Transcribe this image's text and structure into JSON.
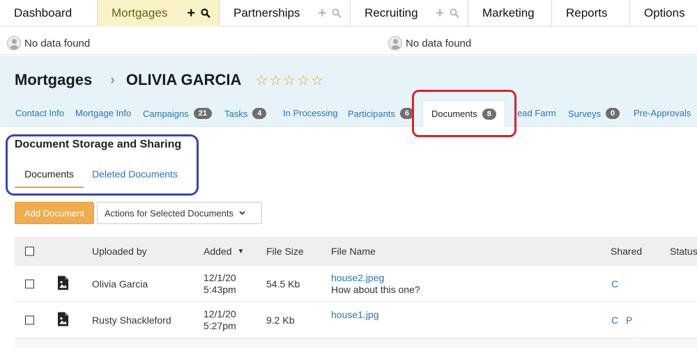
{
  "topnav": {
    "dashboard": "Dashboard",
    "mortgages": "Mortgages",
    "partnerships": "Partnerships",
    "recruiting": "Recruiting",
    "marketing": "Marketing",
    "reports": "Reports",
    "options": "Options",
    "plus": "+",
    "search_icon": "search-icon"
  },
  "status": {
    "left": "No data found",
    "right": "No data found"
  },
  "header": {
    "module": "Mortgages",
    "separator": "›",
    "name": "OLIVIA GARCIA",
    "rating": 0,
    "rating_max": 5,
    "star": "☆"
  },
  "subtabs": {
    "contact_info": "Contact Info",
    "mortgage_info": "Mortgage Info",
    "campaigns": "Campaigns",
    "campaigns_count": "21",
    "tasks": "Tasks",
    "tasks_count": "4",
    "in_processing": "In Processing",
    "participants": "Participants",
    "participants_count": "6",
    "documents": "Documents",
    "documents_count": "8",
    "lead_farm": "ead Farm",
    "surveys": "Surveys",
    "surveys_count": "0",
    "pre_approvals": "Pre-Approvals"
  },
  "section": {
    "title": "Document Storage and Sharing",
    "tab_documents": "Documents",
    "tab_deleted": "Deleted Documents"
  },
  "actions": {
    "add": "Add Document",
    "selected": "Actions for Selected Documents",
    "chevron": "⌄"
  },
  "table": {
    "headers": {
      "uploaded_by": "Uploaded by",
      "added": "Added",
      "sort_indicator": "▼",
      "file_size": "File Size",
      "file_name": "File Name",
      "shared": "Shared",
      "status": "Status"
    },
    "rows": [
      {
        "uploaded_by": "Olivia Garcia",
        "date": "12/1/20",
        "time": "5:43pm",
        "size": "54.5 Kb",
        "file": "house2.jpeg",
        "note": "How about this one?",
        "shared_c": "C",
        "shared_p": ""
      },
      {
        "uploaded_by": "Rusty Shackleford",
        "date": "12/1/20",
        "time": "5:27pm",
        "size": "9.2 Kb",
        "file": "house1.jpg",
        "note": "",
        "shared_c": "C",
        "shared_p": "P"
      }
    ]
  },
  "colors": {
    "accent": "#f0ad4e",
    "link": "#2a74b8",
    "active_nav": "#fbf3c8",
    "header_bg": "#e6f4f9",
    "annotation_red": "#e0202a",
    "annotation_blue": "#3a43b6",
    "stars": "#e8a317"
  }
}
